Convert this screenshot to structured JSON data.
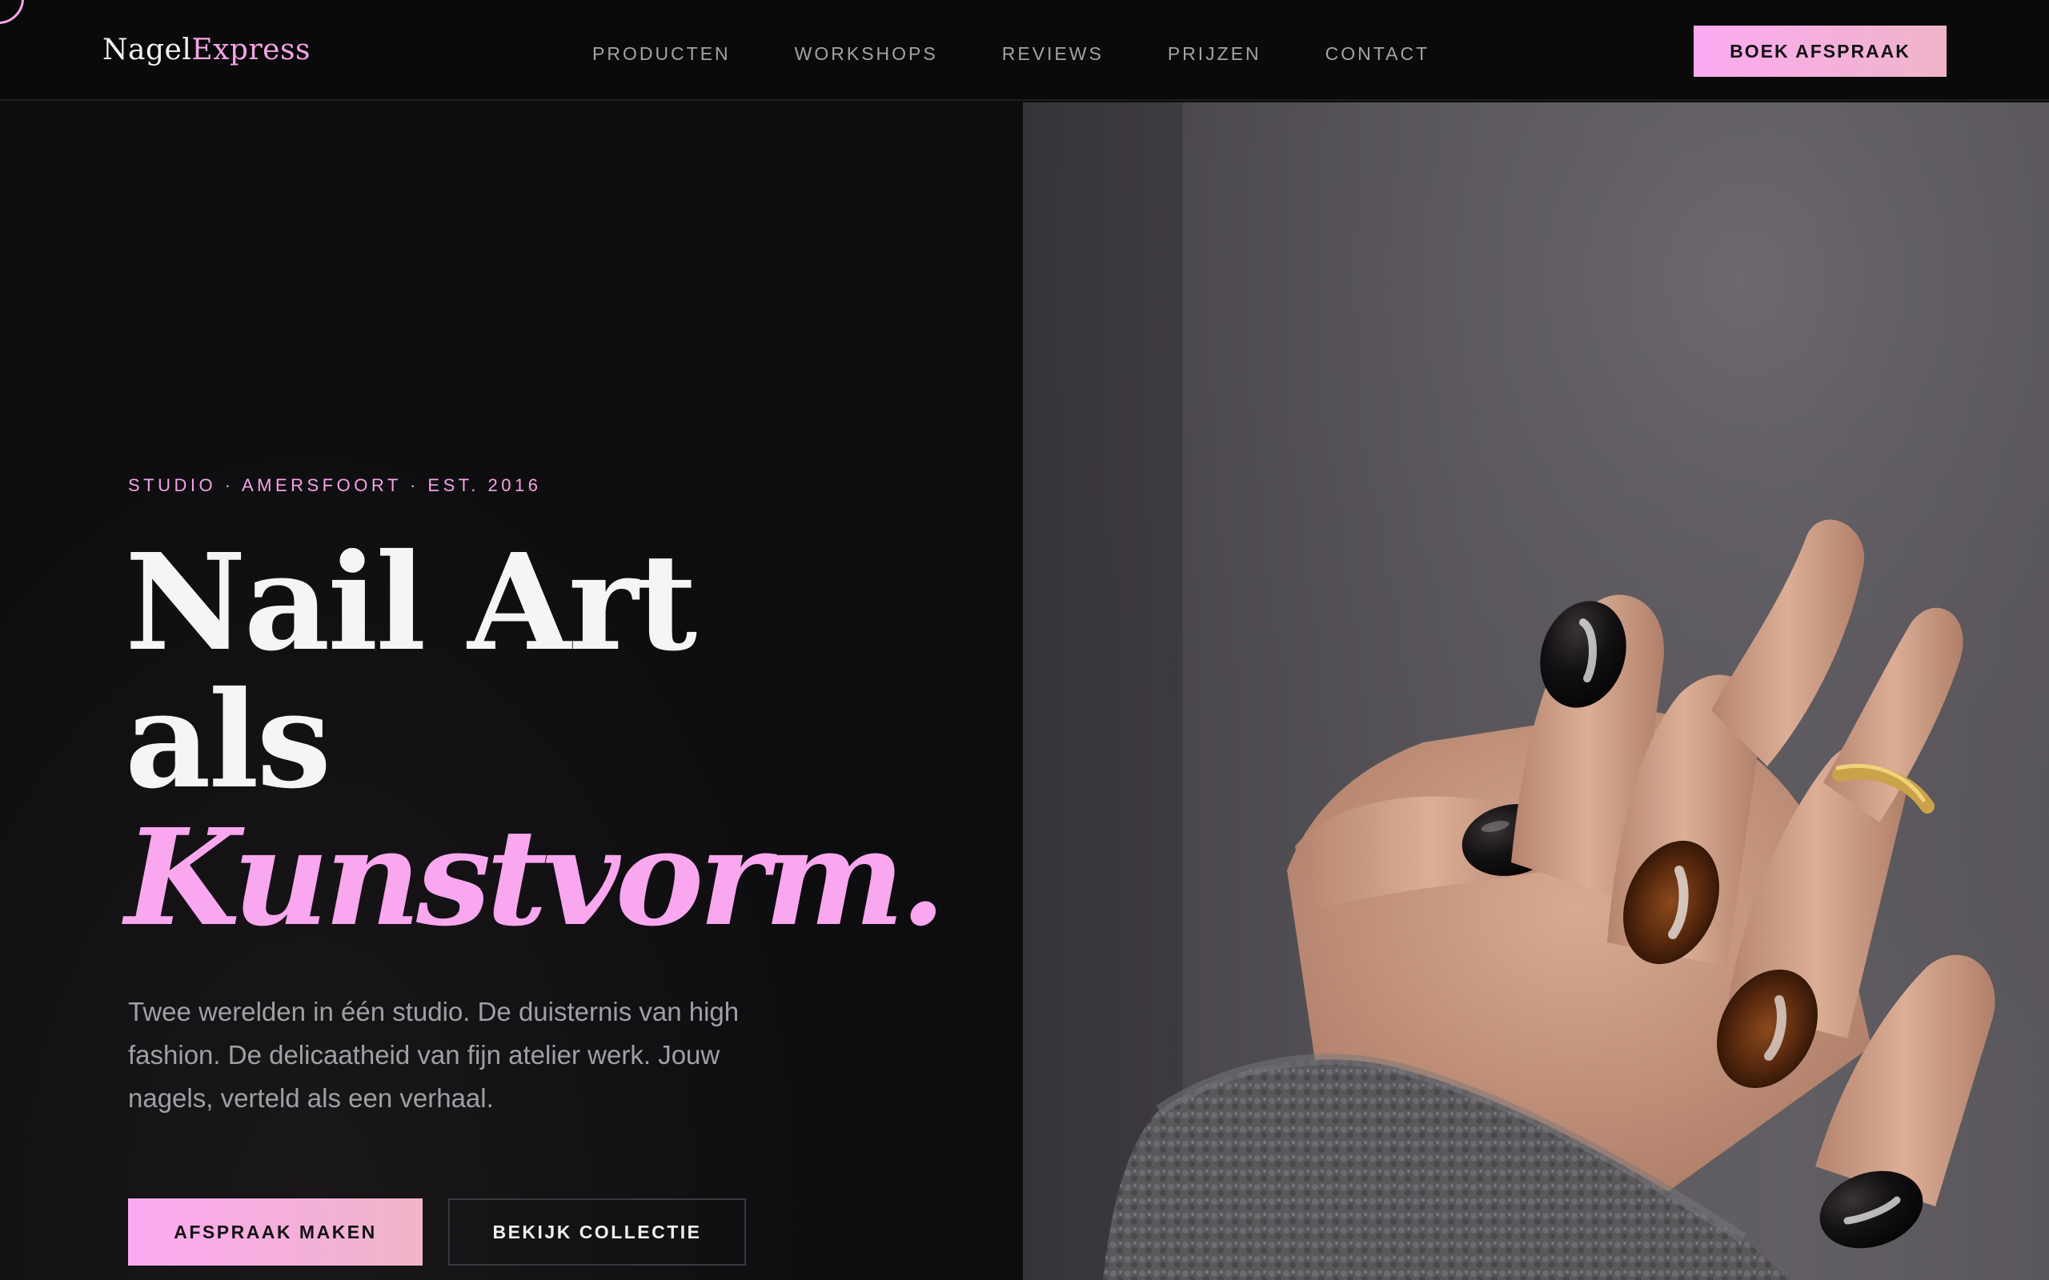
{
  "header": {
    "brand_part1": "Nagel",
    "brand_part2": "Express",
    "nav": [
      {
        "label": "PRODUCTEN"
      },
      {
        "label": "WORKSHOPS"
      },
      {
        "label": "REVIEWS"
      },
      {
        "label": "PRIJZEN"
      },
      {
        "label": "CONTACT"
      }
    ],
    "cta_label": "BOEK AFSPRAAK"
  },
  "hero": {
    "eyebrow": "STUDIO · AMERSFOORT · EST. 2016",
    "title_line1": "Nail Art",
    "title_line2": "als",
    "title_accent": "Kunstvorm.",
    "description": "Twee werelden in één studio. De duisternis van high fashion. De delicaatheid van fijn atelier werk. Jouw nagels, verteld als een verhaal.",
    "primary_button": "AFSPRAAK MAKEN",
    "secondary_button": "BEKIJK COLLECTIE"
  },
  "colors": {
    "accent_pink": "#f6a3e8",
    "background": "#0d0c0e",
    "header_bg": "#0a0a0b",
    "text_light": "#f7f5f4",
    "text_muted": "#a19fa3"
  },
  "image": {
    "icon": "hand-with-dark-polished-nails-photo"
  }
}
